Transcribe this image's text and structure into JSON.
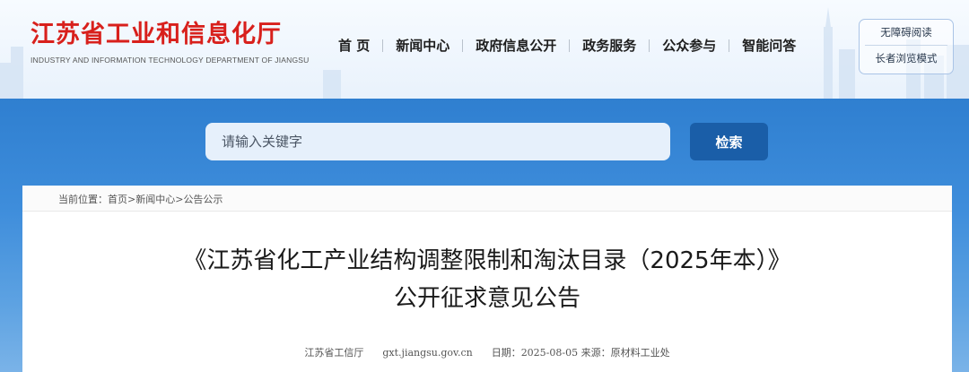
{
  "header": {
    "logo_cn": "江苏省工业和信息化厅",
    "logo_en": "INDUSTRY AND INFORMATION TECHNOLOGY DEPARTMENT OF JIANGSU",
    "nav": [
      "首 页",
      "新闻中心",
      "政府信息公开",
      "政务服务",
      "公众参与",
      "智能问答"
    ],
    "accessibility": [
      "无障碍阅读",
      "长者浏览模式"
    ]
  },
  "search": {
    "placeholder": "请输入关键字",
    "button": "检索"
  },
  "breadcrumb": {
    "prefix": "当前位置：",
    "items": [
      "首页",
      "新闻中心",
      "公告公示"
    ],
    "separator": ">"
  },
  "article": {
    "title_line1": "《江苏省化工产业结构调整限制和淘汰目录（2025年本）》",
    "title_line2": "公开征求意见公告",
    "publisher": "江苏省工信厅",
    "site": "gxt.jiangsu.gov.cn",
    "date_label": "日期：",
    "date": "2025-08-05",
    "source_label": "来源：",
    "source": "原材料工业处"
  },
  "colors": {
    "logo_red": "#d8201c",
    "band_blue": "#2f7fd0",
    "search_button": "#1a5ea8"
  }
}
